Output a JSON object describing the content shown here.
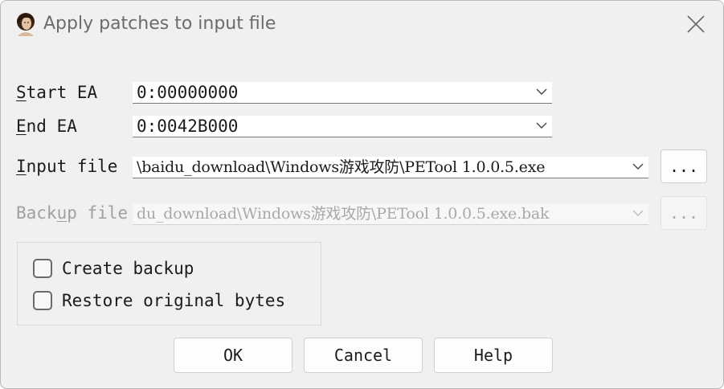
{
  "window": {
    "title": "Apply patches to input file"
  },
  "fields": {
    "start_ea": {
      "label": "Start EA",
      "value": "0:00000000"
    },
    "end_ea": {
      "label": "End EA",
      "value": "0:0042B000"
    },
    "input_file": {
      "label": "Input file",
      "value": "\\baidu_download\\Windows游戏攻防\\PETool 1.0.0.5.exe",
      "browse_label": "..."
    },
    "backup_file": {
      "label": "Backup file",
      "value": "du_download\\Windows游戏攻防\\PETool 1.0.0.5.exe.bak",
      "browse_label": "..."
    }
  },
  "options": {
    "create_backup": {
      "label": "Create backup",
      "checked": false
    },
    "restore_original": {
      "label": "Restore original bytes",
      "checked": false
    }
  },
  "buttons": {
    "ok": "OK",
    "cancel": "Cancel",
    "help": "Help"
  },
  "icons": {
    "app": "portrait-icon",
    "close": "close-icon",
    "dropdown": "chevron-down-icon"
  },
  "colors": {
    "background": "#f0f0f0",
    "field_background": "#ffffff",
    "disabled_text": "#a0a0a0"
  }
}
